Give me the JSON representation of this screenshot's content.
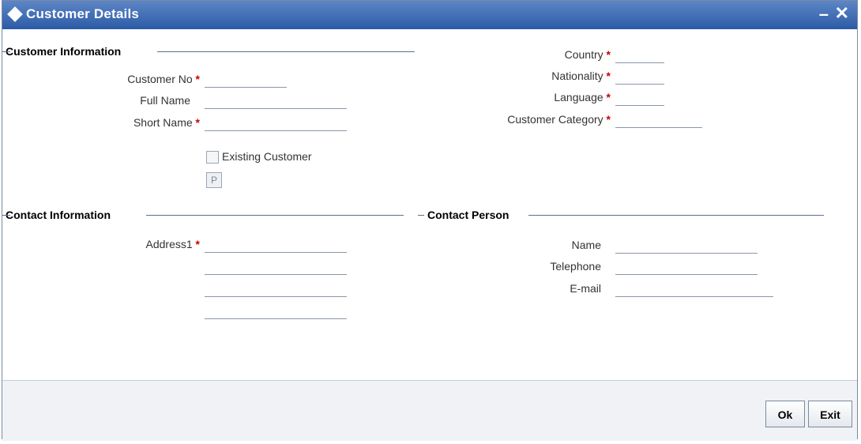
{
  "window": {
    "title": "Customer Details"
  },
  "sections": {
    "customer_information": "Customer Information",
    "contact_information": "Contact Information",
    "contact_person": "Contact Person"
  },
  "fields": {
    "customer_no": {
      "label": "Customer No",
      "value": ""
    },
    "full_name": {
      "label": "Full Name",
      "value": ""
    },
    "short_name": {
      "label": "Short Name",
      "value": ""
    },
    "country": {
      "label": "Country",
      "value": ""
    },
    "nationality": {
      "label": "Nationality",
      "value": ""
    },
    "language": {
      "label": "Language",
      "value": ""
    },
    "customer_category": {
      "label": "Customer Category",
      "value": ""
    },
    "address1": {
      "label": "Address1",
      "value": ""
    },
    "address2": {
      "value": ""
    },
    "address3": {
      "value": ""
    },
    "address4": {
      "value": ""
    },
    "contact_name": {
      "label": "Name",
      "value": ""
    },
    "telephone": {
      "label": "Telephone",
      "value": ""
    },
    "email": {
      "label": "E-mail",
      "value": ""
    }
  },
  "required_marker": "*",
  "existing_customer": {
    "label": "Existing Customer",
    "checked": false
  },
  "p_button": "P",
  "buttons": {
    "ok": "Ok",
    "exit": "Exit"
  },
  "colors": {
    "titlebar": "#2c5ba6",
    "required": "#cc0000"
  }
}
